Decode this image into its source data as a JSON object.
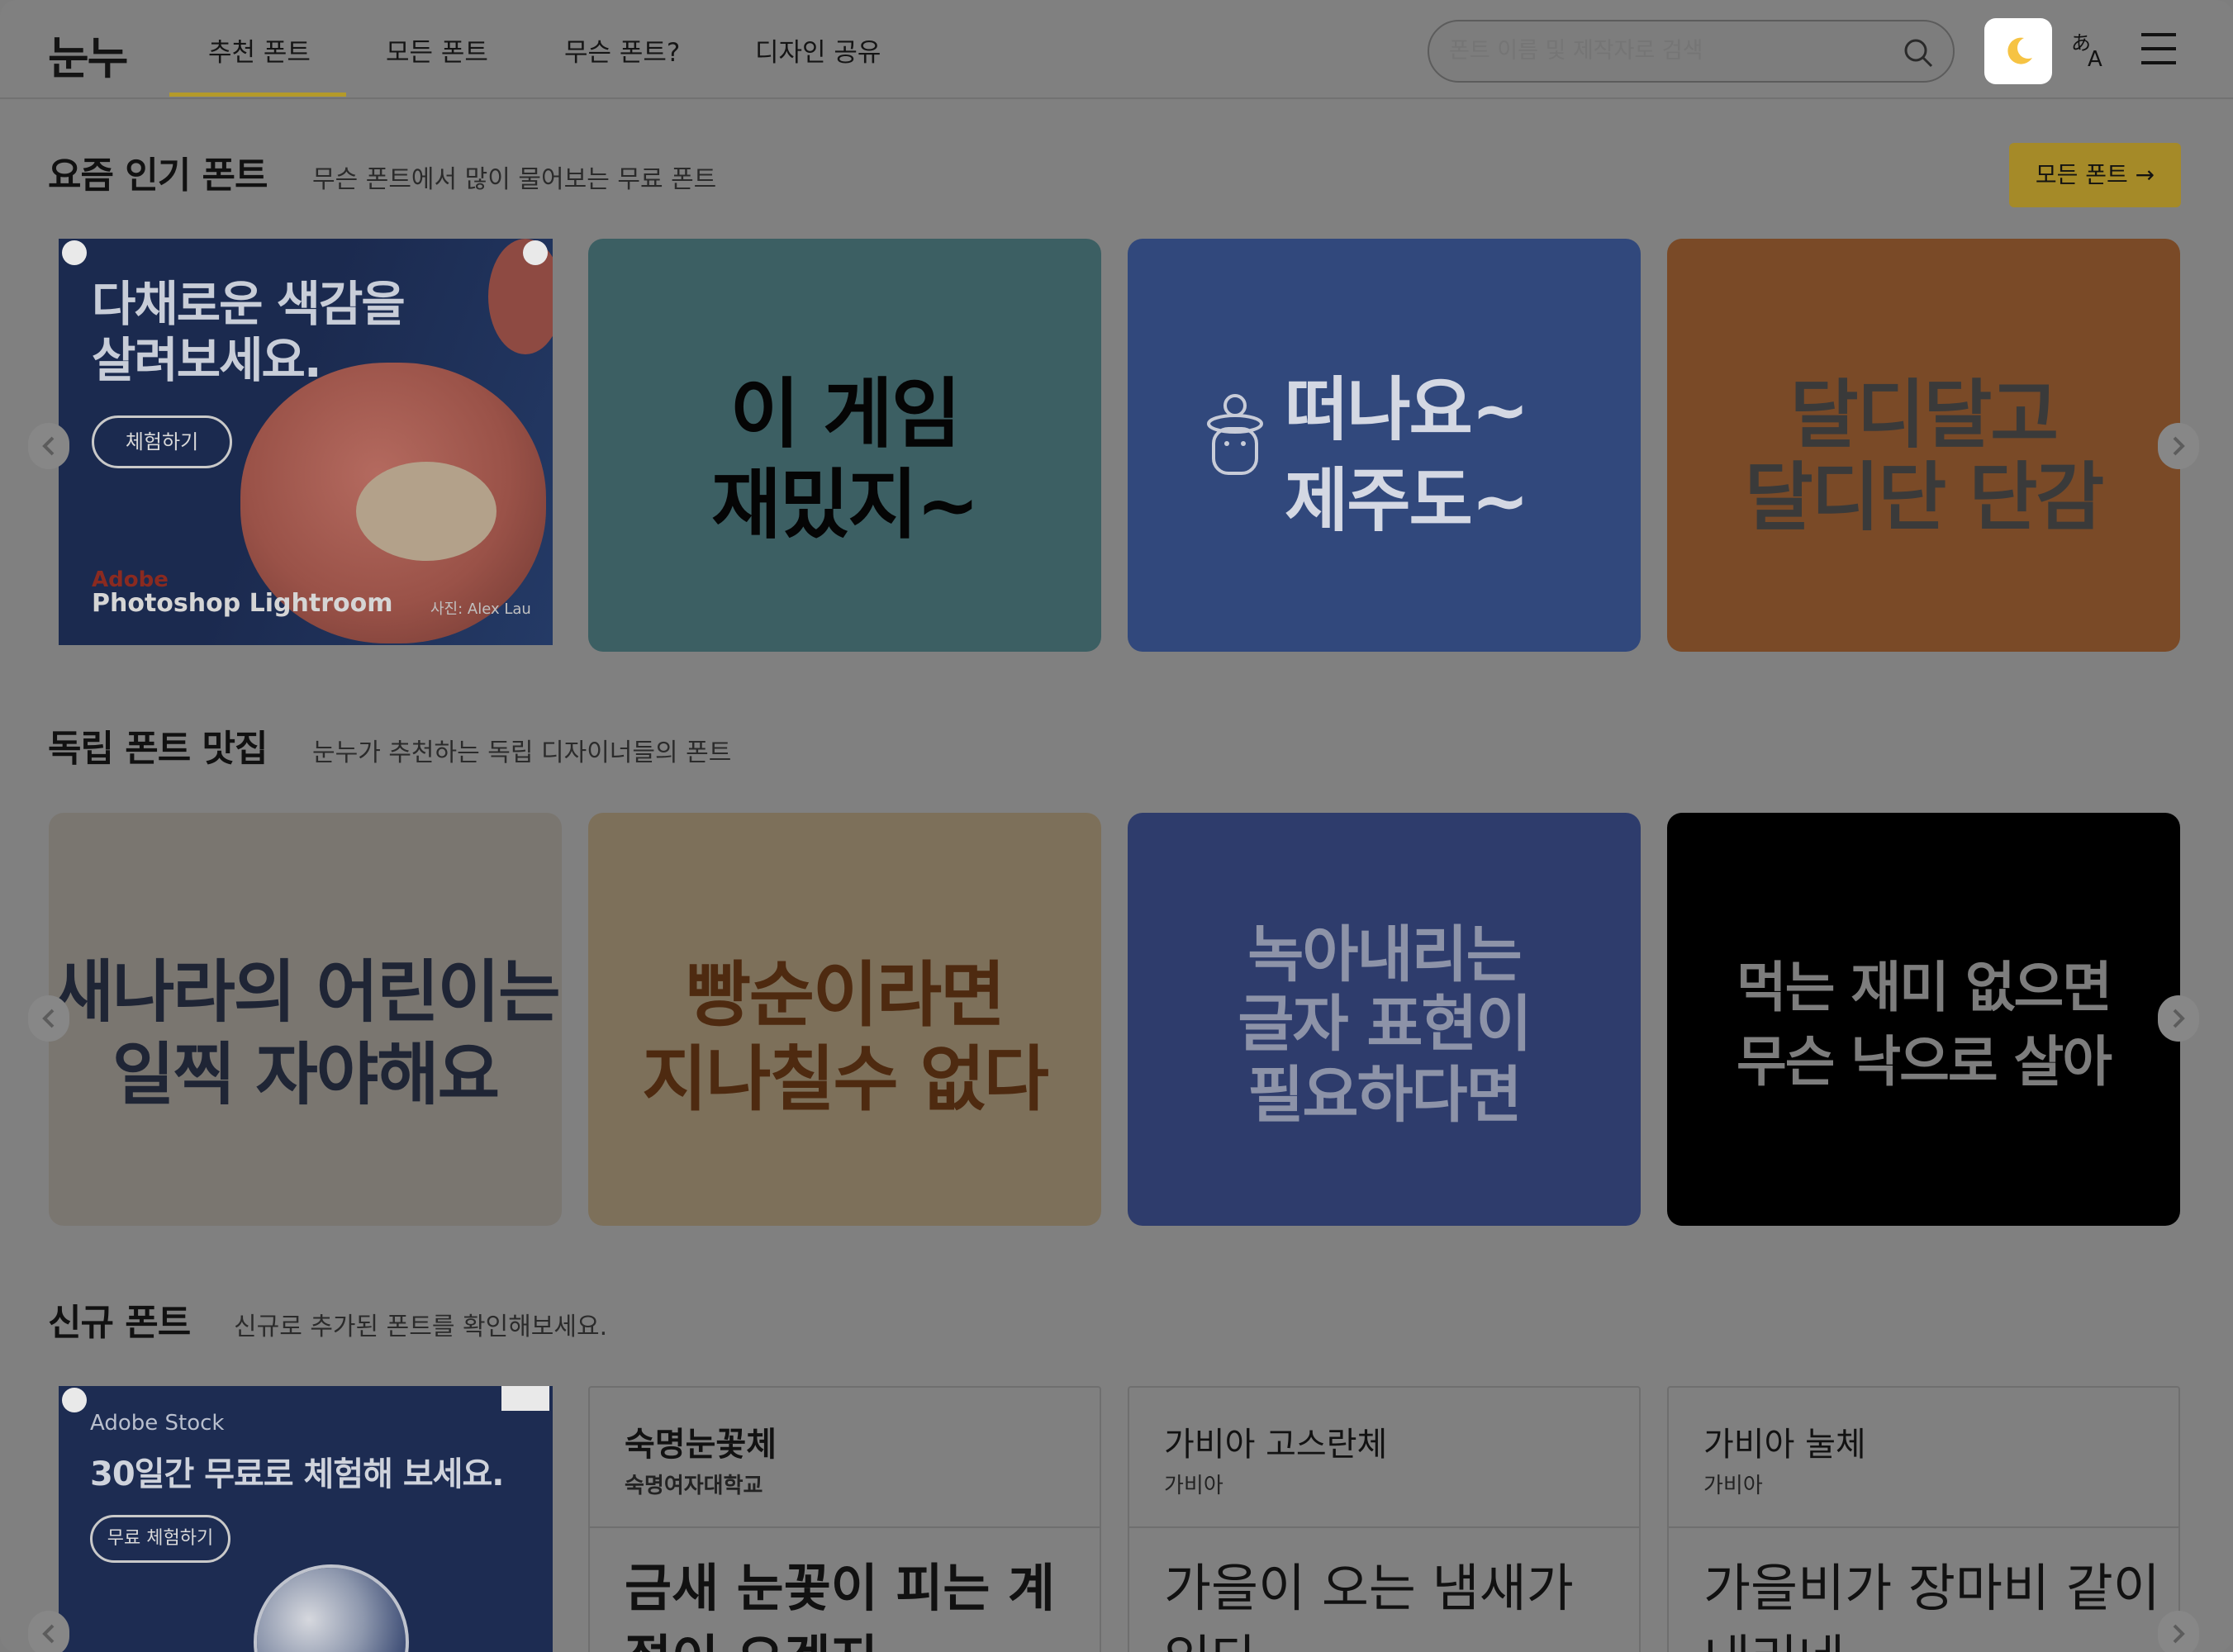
{
  "header": {
    "logo": "눈누",
    "nav": [
      "추천 폰트",
      "모든 폰트",
      "무슨 폰트?",
      "디자인 공유"
    ],
    "active_nav": 0,
    "search_placeholder": "폰트 이름 및 제작자로 검색",
    "icons": [
      "search-icon",
      "moon-icon",
      "translate-icon",
      "menu-icon"
    ]
  },
  "popular": {
    "title": "요즘 인기 폰트",
    "subtitle": "무슨 폰트에서 많이 물어보는 무료 폰트",
    "all_button": "모든 폰트 →",
    "ad": {
      "headline_1": "다채로운 색감을",
      "headline_2": "살려보세요.",
      "cta": "체험하기",
      "brand": "Adobe",
      "product": "Photoshop Lightroom",
      "credit": "사진: Alex Lau"
    },
    "cards": [
      {
        "line1": "이 게임",
        "line2": "재밌지~",
        "bg": "#3c5f63",
        "fg": "#050505"
      },
      {
        "line1": "떠나요~",
        "line2": "제주도~",
        "bg": "#31487c",
        "fg": "#d4d8e3"
      },
      {
        "line1": "달디달고",
        "line2": "달디단 단감",
        "bg": "#7a4a27",
        "fg": "#3a3a3a"
      }
    ]
  },
  "indie": {
    "title": "독립 폰트 맛집",
    "subtitle": "눈누가 추천하는 독립 디자이너들의 폰트",
    "cards": [
      {
        "line1": "새나라의 어린이는",
        "line2": "일찍 자야해요",
        "line3": "",
        "bg": "#7a7670",
        "fg": "#1f2535"
      },
      {
        "line1": "빵순이라면",
        "line2": "지나칠수 없다",
        "line3": "",
        "bg": "#7d705a",
        "fg": "#4e2a10"
      },
      {
        "line1": "녹아내리는",
        "line2": "글자 표현이",
        "line3": "필요하다면",
        "bg": "#2e3c6c",
        "fg": "#8d93a8"
      },
      {
        "line1": "먹는 재미 없으면",
        "line2": "무슨 낙으로 살아",
        "line3": "",
        "bg": "#000000",
        "fg": "#7d7d7d"
      }
    ]
  },
  "new_fonts": {
    "title": "신규 폰트",
    "subtitle": "신규로 추가된 폰트를 확인해보세요.",
    "ad": {
      "brand": "Adobe Stock",
      "headline": "30일간 무료로 체험해 보세요.",
      "cta": "무료 체험하기"
    },
    "cards": [
      {
        "name": "숙명눈꽃체",
        "author": "숙명여자대학교",
        "sample": "금새 눈꽃이 피는 계절이 오겠지"
      },
      {
        "name": "가비아 고스란체",
        "author": "가비아",
        "sample": "가을이 오는 냄새가 있다"
      },
      {
        "name": "가비아 눌체",
        "author": "가비아",
        "sample": "가을비가 장마비 같이 내리네"
      }
    ]
  }
}
